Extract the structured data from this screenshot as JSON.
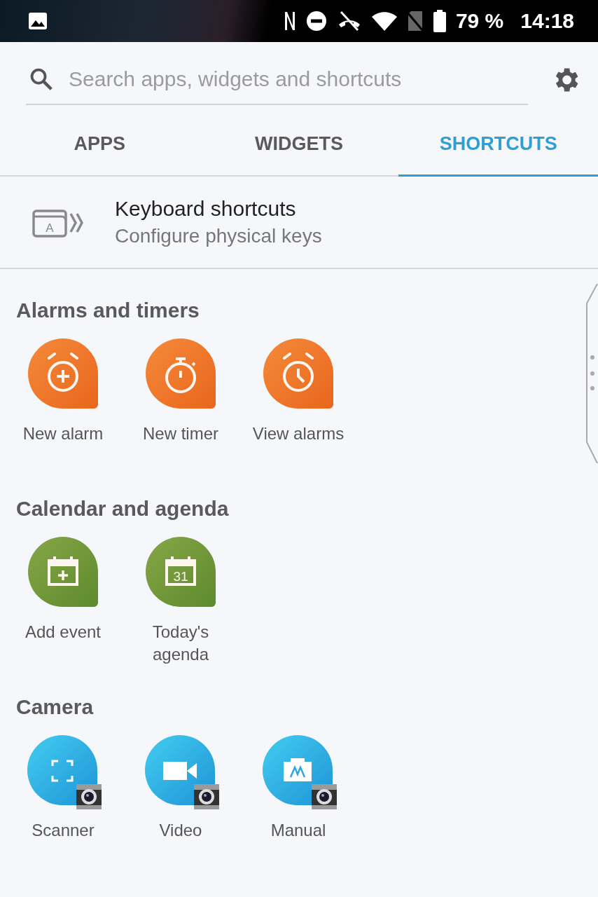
{
  "status_bar": {
    "battery": "79 %",
    "time": "14:18"
  },
  "search": {
    "placeholder": "Search apps, widgets and shortcuts"
  },
  "tabs": [
    {
      "label": "APPS",
      "selected": false
    },
    {
      "label": "WIDGETS",
      "selected": false
    },
    {
      "label": "SHORTCUTS",
      "selected": true
    }
  ],
  "featured": {
    "key": "A",
    "title": "Keyboard shortcuts",
    "subtitle": "Configure physical keys"
  },
  "sections": [
    {
      "title": "Alarms and timers",
      "items": [
        {
          "label": "New alarm",
          "kind": "alarm-add"
        },
        {
          "label": "New timer",
          "kind": "timer"
        },
        {
          "label": "View alarms",
          "kind": "alarm-view"
        }
      ]
    },
    {
      "title": "Calendar and agenda",
      "items": [
        {
          "label": "Add event",
          "kind": "calendar-add"
        },
        {
          "label": "Today's agenda",
          "kind": "calendar-today",
          "day": "31"
        }
      ]
    },
    {
      "title": "Camera",
      "items": [
        {
          "label": "Scanner",
          "kind": "scanner"
        },
        {
          "label": "Video",
          "kind": "video"
        },
        {
          "label": "Manual",
          "kind": "manual"
        }
      ]
    }
  ]
}
